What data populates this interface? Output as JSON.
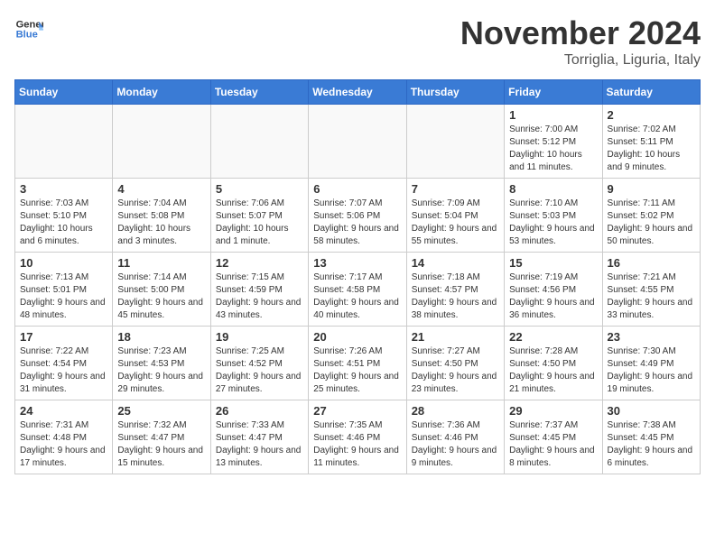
{
  "header": {
    "logo_general": "General",
    "logo_blue": "Blue",
    "month": "November 2024",
    "location": "Torriglia, Liguria, Italy"
  },
  "days_of_week": [
    "Sunday",
    "Monday",
    "Tuesday",
    "Wednesday",
    "Thursday",
    "Friday",
    "Saturday"
  ],
  "weeks": [
    [
      {
        "day": "",
        "info": ""
      },
      {
        "day": "",
        "info": ""
      },
      {
        "day": "",
        "info": ""
      },
      {
        "day": "",
        "info": ""
      },
      {
        "day": "",
        "info": ""
      },
      {
        "day": "1",
        "info": "Sunrise: 7:00 AM\nSunset: 5:12 PM\nDaylight: 10 hours and 11 minutes."
      },
      {
        "day": "2",
        "info": "Sunrise: 7:02 AM\nSunset: 5:11 PM\nDaylight: 10 hours and 9 minutes."
      }
    ],
    [
      {
        "day": "3",
        "info": "Sunrise: 7:03 AM\nSunset: 5:10 PM\nDaylight: 10 hours and 6 minutes."
      },
      {
        "day": "4",
        "info": "Sunrise: 7:04 AM\nSunset: 5:08 PM\nDaylight: 10 hours and 3 minutes."
      },
      {
        "day": "5",
        "info": "Sunrise: 7:06 AM\nSunset: 5:07 PM\nDaylight: 10 hours and 1 minute."
      },
      {
        "day": "6",
        "info": "Sunrise: 7:07 AM\nSunset: 5:06 PM\nDaylight: 9 hours and 58 minutes."
      },
      {
        "day": "7",
        "info": "Sunrise: 7:09 AM\nSunset: 5:04 PM\nDaylight: 9 hours and 55 minutes."
      },
      {
        "day": "8",
        "info": "Sunrise: 7:10 AM\nSunset: 5:03 PM\nDaylight: 9 hours and 53 minutes."
      },
      {
        "day": "9",
        "info": "Sunrise: 7:11 AM\nSunset: 5:02 PM\nDaylight: 9 hours and 50 minutes."
      }
    ],
    [
      {
        "day": "10",
        "info": "Sunrise: 7:13 AM\nSunset: 5:01 PM\nDaylight: 9 hours and 48 minutes."
      },
      {
        "day": "11",
        "info": "Sunrise: 7:14 AM\nSunset: 5:00 PM\nDaylight: 9 hours and 45 minutes."
      },
      {
        "day": "12",
        "info": "Sunrise: 7:15 AM\nSunset: 4:59 PM\nDaylight: 9 hours and 43 minutes."
      },
      {
        "day": "13",
        "info": "Sunrise: 7:17 AM\nSunset: 4:58 PM\nDaylight: 9 hours and 40 minutes."
      },
      {
        "day": "14",
        "info": "Sunrise: 7:18 AM\nSunset: 4:57 PM\nDaylight: 9 hours and 38 minutes."
      },
      {
        "day": "15",
        "info": "Sunrise: 7:19 AM\nSunset: 4:56 PM\nDaylight: 9 hours and 36 minutes."
      },
      {
        "day": "16",
        "info": "Sunrise: 7:21 AM\nSunset: 4:55 PM\nDaylight: 9 hours and 33 minutes."
      }
    ],
    [
      {
        "day": "17",
        "info": "Sunrise: 7:22 AM\nSunset: 4:54 PM\nDaylight: 9 hours and 31 minutes."
      },
      {
        "day": "18",
        "info": "Sunrise: 7:23 AM\nSunset: 4:53 PM\nDaylight: 9 hours and 29 minutes."
      },
      {
        "day": "19",
        "info": "Sunrise: 7:25 AM\nSunset: 4:52 PM\nDaylight: 9 hours and 27 minutes."
      },
      {
        "day": "20",
        "info": "Sunrise: 7:26 AM\nSunset: 4:51 PM\nDaylight: 9 hours and 25 minutes."
      },
      {
        "day": "21",
        "info": "Sunrise: 7:27 AM\nSunset: 4:50 PM\nDaylight: 9 hours and 23 minutes."
      },
      {
        "day": "22",
        "info": "Sunrise: 7:28 AM\nSunset: 4:50 PM\nDaylight: 9 hours and 21 minutes."
      },
      {
        "day": "23",
        "info": "Sunrise: 7:30 AM\nSunset: 4:49 PM\nDaylight: 9 hours and 19 minutes."
      }
    ],
    [
      {
        "day": "24",
        "info": "Sunrise: 7:31 AM\nSunset: 4:48 PM\nDaylight: 9 hours and 17 minutes."
      },
      {
        "day": "25",
        "info": "Sunrise: 7:32 AM\nSunset: 4:47 PM\nDaylight: 9 hours and 15 minutes."
      },
      {
        "day": "26",
        "info": "Sunrise: 7:33 AM\nSunset: 4:47 PM\nDaylight: 9 hours and 13 minutes."
      },
      {
        "day": "27",
        "info": "Sunrise: 7:35 AM\nSunset: 4:46 PM\nDaylight: 9 hours and 11 minutes."
      },
      {
        "day": "28",
        "info": "Sunrise: 7:36 AM\nSunset: 4:46 PM\nDaylight: 9 hours and 9 minutes."
      },
      {
        "day": "29",
        "info": "Sunrise: 7:37 AM\nSunset: 4:45 PM\nDaylight: 9 hours and 8 minutes."
      },
      {
        "day": "30",
        "info": "Sunrise: 7:38 AM\nSunset: 4:45 PM\nDaylight: 9 hours and 6 minutes."
      }
    ]
  ]
}
